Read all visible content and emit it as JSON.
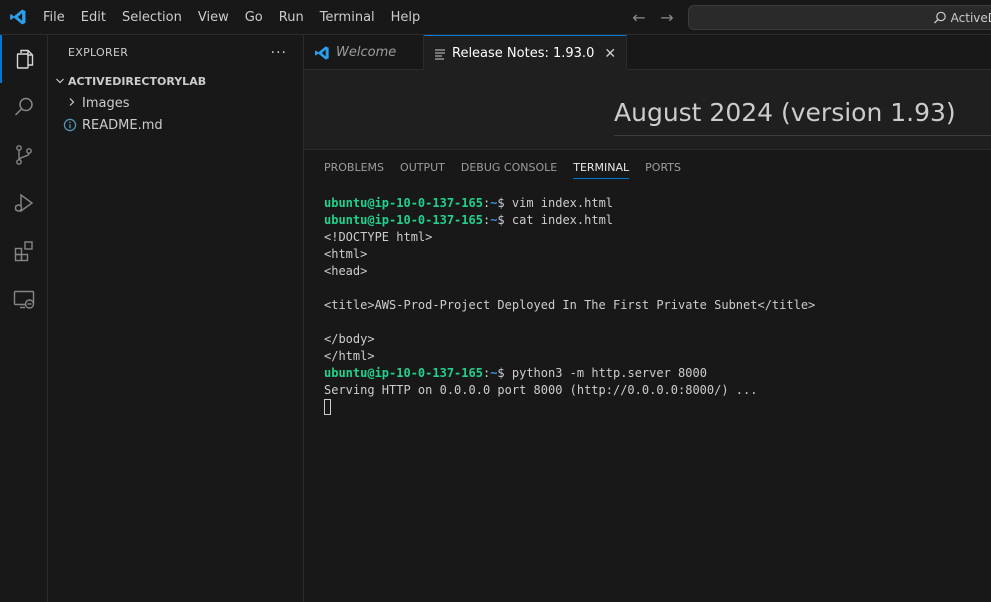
{
  "titlebar": {
    "menu": [
      "File",
      "Edit",
      "Selection",
      "View",
      "Go",
      "Run",
      "Terminal",
      "Help"
    ],
    "command_center_text": "ActiveD",
    "accent_color": "#0078d4"
  },
  "activity_bar": {
    "items": [
      "explorer-icon",
      "search-icon",
      "source-control-icon",
      "run-debug-icon",
      "extensions-icon",
      "remote-explorer-icon"
    ]
  },
  "sidebar": {
    "title": "EXPLORER",
    "more": "···",
    "section_title": "ACTIVEDIRECTORYLAB",
    "tree": [
      {
        "label": "Images",
        "type": "folder"
      },
      {
        "label": "README.md",
        "type": "file"
      }
    ]
  },
  "tabs": [
    {
      "label": "Welcome",
      "active": false
    },
    {
      "label": "Release Notes: 1.93.0",
      "active": true
    }
  ],
  "editor": {
    "heading": "August 2024 (version 1.93)"
  },
  "panel": {
    "tabs": [
      "PROBLEMS",
      "OUTPUT",
      "DEBUG CONSOLE",
      "TERMINAL",
      "PORTS"
    ],
    "active_tab": "TERMINAL"
  },
  "terminal": {
    "prompt_user": "ubuntu@ip-10-0-137-165",
    "prompt_sep": ":",
    "prompt_path": "~",
    "prompt_symbol": "$ ",
    "lines": [
      {
        "kind": "cmd",
        "text": "vim index.html"
      },
      {
        "kind": "cmd",
        "text": "cat index.html"
      },
      {
        "kind": "out",
        "text": "<!DOCTYPE html>"
      },
      {
        "kind": "out",
        "text": "<html>"
      },
      {
        "kind": "out",
        "text": "<head>"
      },
      {
        "kind": "out",
        "text": ""
      },
      {
        "kind": "out",
        "text": "<title>AWS-Prod-Project Deployed In The First Private Subnet</title>"
      },
      {
        "kind": "out",
        "text": ""
      },
      {
        "kind": "out",
        "text": "</body>"
      },
      {
        "kind": "out",
        "text": "</html>"
      },
      {
        "kind": "cmd",
        "text": "python3 -m http.server 8000"
      },
      {
        "kind": "out",
        "text": "Serving HTTP on 0.0.0.0 port 8000 (http://0.0.0.0:8000/) ..."
      }
    ]
  }
}
